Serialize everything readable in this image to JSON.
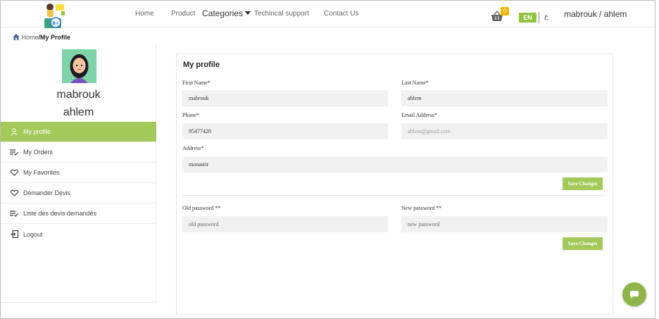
{
  "header": {
    "nav": {
      "home": "Home",
      "product": "Product",
      "categories": "Categories",
      "support": "Techincal support",
      "contact": "Contact Us"
    },
    "cart_count": "0",
    "lang_en": "EN",
    "lang_ar": "ع",
    "user": "mabrouk / ahlem"
  },
  "breadcrumb": {
    "home": "Home",
    "current": "/My Profile"
  },
  "sidebar": {
    "first_name": "mabrouk",
    "last_name": "ahlem",
    "items": [
      {
        "label": "My profile",
        "icon": "user-icon"
      },
      {
        "label": "My Orders",
        "icon": "list-check-icon"
      },
      {
        "label": "My Favorites",
        "icon": "heart-icon"
      },
      {
        "label": "Demander Devis",
        "icon": "heart-icon"
      },
      {
        "label": "Liste des devis demandés",
        "icon": "list-check-icon"
      },
      {
        "label": "Logout",
        "icon": "logout-icon"
      }
    ]
  },
  "profile": {
    "title": "My profile",
    "first_name": {
      "label": "First Name*",
      "value": "mabrouk"
    },
    "last_name": {
      "label": "Last Name*",
      "value": "ahlem"
    },
    "phone": {
      "label": "Phone*",
      "value": "95477420"
    },
    "email": {
      "label": "Email Address*",
      "value": "ahlem@gmail.com"
    },
    "address": {
      "label": "Address*",
      "value": "monastir"
    },
    "save_label": "Save Changes"
  },
  "password": {
    "old": {
      "label": "Old password **",
      "placeholder": "old password"
    },
    "new": {
      "label": "New password **",
      "placeholder": "new password"
    },
    "save_label": "Save Changes"
  },
  "colors": {
    "accent": "#a2c95a",
    "badge": "#f0b400",
    "chat": "#8fb449"
  }
}
